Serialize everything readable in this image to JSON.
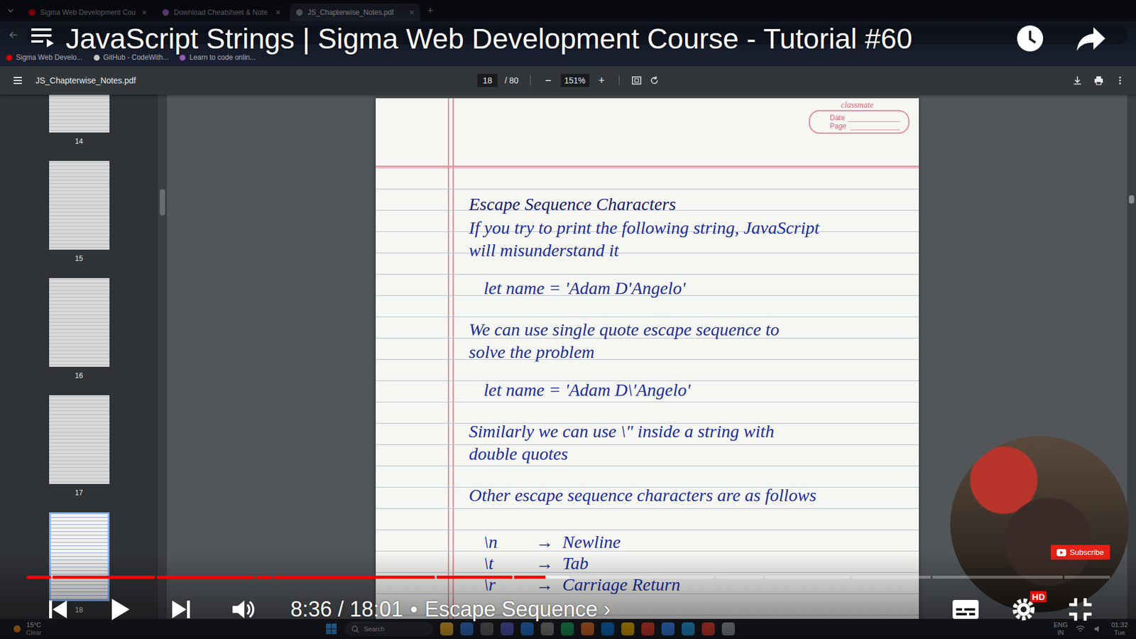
{
  "browser": {
    "tabs": [
      {
        "label": "Sigma Web Development Cou",
        "close": "×",
        "selected": false,
        "color": "#ff0000"
      },
      {
        "label": "Download Cheatsheet & Note",
        "close": "×",
        "selected": false,
        "color": "#b06bd6"
      },
      {
        "label": "JS_Chapterwise_Notes.pdf",
        "close": "×",
        "selected": true,
        "color": "#9aa0a6"
      }
    ],
    "new_tab": "+",
    "bookmarks": [
      {
        "label": "Sigma Web Develo...",
        "color": "#ff0000"
      },
      {
        "label": "GitHub - CodeWith...",
        "color": "#e8e8e8"
      },
      {
        "label": "Learn to code onlin...",
        "color": "#b06bd6"
      }
    ]
  },
  "video_title": "JavaScript Strings | Sigma Web Development Course - Tutorial #60",
  "pdf": {
    "filename": "JS_Chapterwise_Notes.pdf",
    "page": "18",
    "total": "/ 80",
    "minus": "−",
    "zoom": "151%",
    "plus": "+",
    "thumbnails": [
      {
        "label": "14",
        "selected": false
      },
      {
        "label": "15",
        "selected": false
      },
      {
        "label": "16",
        "selected": false
      },
      {
        "label": "17",
        "selected": false
      },
      {
        "label": "18",
        "selected": true
      }
    ]
  },
  "notes": {
    "brand": "classmate",
    "date_label": "Date",
    "page_label": "Page",
    "lines": [
      {
        "text": "Escape Sequence Characters",
        "kind": "heading"
      },
      {
        "text": "If you try to print the following string, JavaScript",
        "kind": "paragraph"
      },
      {
        "text": "will misunderstand it",
        "kind": "continuation"
      },
      {
        "text": "let name = 'Adam D'Angelo'",
        "kind": "code"
      },
      {
        "text": "We can use single quote escape sequence to",
        "kind": "paragraph"
      },
      {
        "text": "solve the problem",
        "kind": "continuation"
      },
      {
        "text": "let name = 'Adam D\\'Angelo'",
        "kind": "code"
      },
      {
        "text": "Similarly we can use \\\" inside a string with",
        "kind": "paragraph"
      },
      {
        "text": "double quotes",
        "kind": "continuation"
      },
      {
        "text": "Other escape sequence characters are as follows",
        "kind": "paragraph"
      }
    ],
    "escapes": [
      {
        "code": "\\n",
        "arrow": "→",
        "meaning": "Newline"
      },
      {
        "code": "\\t",
        "arrow": "→",
        "meaning": "Tab"
      },
      {
        "code": "\\r",
        "arrow": "→",
        "meaning": "Carriage Return"
      }
    ]
  },
  "player": {
    "progress": {
      "level": 0.478,
      "buffered": 0.5,
      "chapters": [
        0.023,
        0.119,
        0.211,
        0.226,
        0.377,
        0.448,
        0.636,
        0.681,
        0.761,
        0.835,
        0.957
      ]
    },
    "time": "8:36 / 18:01",
    "separator": "•",
    "chapter": "Escape Sequence",
    "chapter_arrow": "›",
    "quality": "HD",
    "subscribe": "Subscribe"
  },
  "taskbar": {
    "temperature": "15°C",
    "weather": "Clear",
    "search": "Search",
    "language": "ENG",
    "region": "IN",
    "time": "01:32",
    "day": "Tue",
    "apps": [
      {
        "color": "#f2b233"
      },
      {
        "color": "#3a7bd5"
      },
      {
        "color": "#6b6b6b"
      },
      {
        "color": "#5b5fc7"
      },
      {
        "color": "#2a7de1"
      },
      {
        "color": "#8a8a8a"
      },
      {
        "color": "#1fa463"
      },
      {
        "color": "#e6732a"
      },
      {
        "color": "#0b7ad6"
      },
      {
        "color": "#f4b400"
      },
      {
        "color": "#e94235"
      },
      {
        "color": "#3d8bfd"
      },
      {
        "color": "#2aa0ea"
      },
      {
        "color": "#ea4335"
      },
      {
        "color": "#9aa0a6"
      }
    ]
  }
}
